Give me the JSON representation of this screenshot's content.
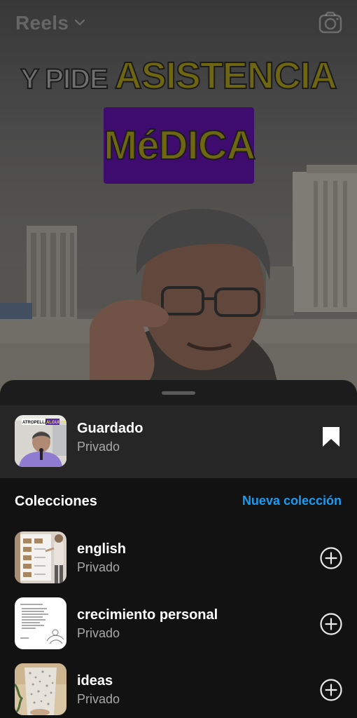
{
  "topbar": {
    "title": "Reels",
    "title_icon": "chevron-down-icon",
    "camera_icon": "camera-icon"
  },
  "video": {
    "caption_line1_a": "Y PIDE ",
    "caption_line1_b": "ASISTENCIA",
    "caption_line2": "MéDICA",
    "colors": {
      "caption_yellow": "#6e6613",
      "caption_box": "#3e0c6e"
    }
  },
  "sheet": {
    "saved": {
      "title": "Guardado",
      "subtitle": "Privado",
      "icon": "bookmark-filled-icon",
      "thumb_banner": "ATROPELLA A ALGUIEN"
    },
    "collections_heading": "Colecciones",
    "new_collection_label": "Nueva colección",
    "collections": [
      {
        "name": "english",
        "privacy": "Privado",
        "icon": "plus-circle-icon"
      },
      {
        "name": "crecimiento personal",
        "privacy": "Privado",
        "icon": "plus-circle-icon"
      },
      {
        "name": "ideas",
        "privacy": "Privado",
        "icon": "plus-circle-icon"
      }
    ],
    "colors": {
      "accent": "#1d9bf0",
      "sheet_bg": "#1c1c1c",
      "saved_row_bg": "#262626",
      "list_bg": "#121212"
    }
  }
}
